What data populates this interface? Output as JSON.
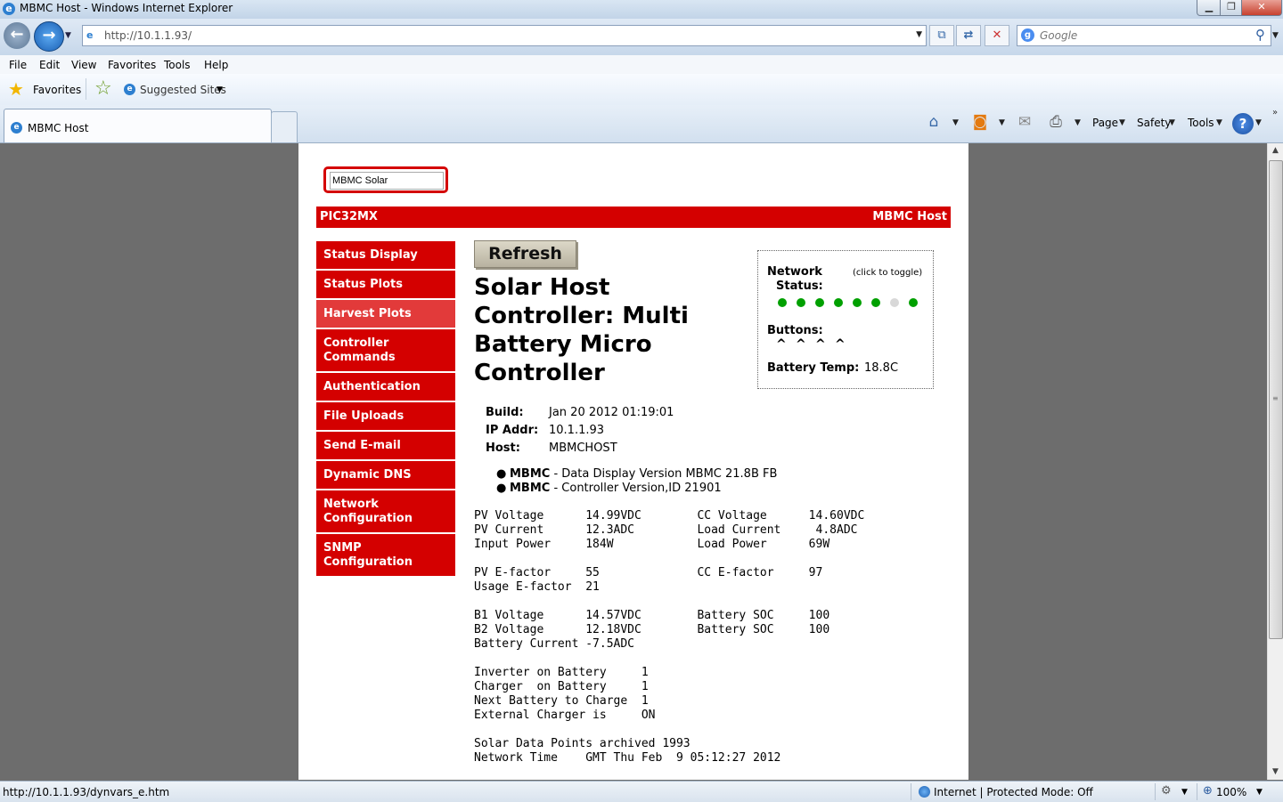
{
  "window": {
    "title": "MBMC Host - Windows Internet Explorer",
    "minimize": "▁",
    "maximize": "❐",
    "close": "✕"
  },
  "address": {
    "url": "http://10.1.1.93/",
    "search_placeholder": "Google"
  },
  "menu": [
    "File",
    "Edit",
    "View",
    "Favorites",
    "Tools",
    "Help"
  ],
  "favorites": {
    "label": "Favorites",
    "suggested": "Suggested Sites"
  },
  "tab": {
    "title": "MBMC Host"
  },
  "commands": {
    "page": "Page",
    "safety": "Safety",
    "tools": "Tools"
  },
  "page": {
    "logo_text": "MBMC Solar",
    "header_left": "PIC32MX",
    "header_right": "MBMC Host",
    "nav": [
      {
        "label": "Status Display"
      },
      {
        "label": "Status Plots"
      },
      {
        "label": "Harvest Plots"
      },
      {
        "line1": "Controller",
        "line2": "Commands"
      },
      {
        "label": "Authentication"
      },
      {
        "label": "File Uploads"
      },
      {
        "label": "Send E-mail"
      },
      {
        "label": "Dynamic DNS"
      },
      {
        "line1": "Network",
        "line2": "Configuration"
      },
      {
        "line1": "SNMP",
        "line2": "Configuration"
      }
    ],
    "refresh_button": "Refresh",
    "title_lines": [
      "Solar Host",
      "Controller: Multi",
      "Battery Micro",
      "Controller"
    ],
    "status": {
      "network_label_1": "Network",
      "network_label_2": "Status:",
      "toggle_hint": "(click to toggle)",
      "leds": [
        "on",
        "on",
        "on",
        "on",
        "on",
        "on",
        "off",
        "on"
      ],
      "led_on_color": "#00a000",
      "led_off_color": "#d8d8d8",
      "buttons_label": "Buttons:",
      "button_glyphs": [
        "^",
        "^",
        "^",
        "^"
      ],
      "battery_temp_label": "Battery Temp:",
      "battery_temp_value": "18.8C"
    },
    "info": [
      {
        "k": "Build:",
        "v": "Jan 20 2012 01:19:01"
      },
      {
        "k": "IP Addr:",
        "v": "10.1.1.93"
      },
      {
        "k": "Host:",
        "v": "MBMCHOST"
      }
    ],
    "versions": [
      {
        "name": "MBMC",
        "text": " - Data Display Version MBMC 21.8B FB"
      },
      {
        "name": "MBMC",
        "text": " - Controller Version,ID 21901"
      }
    ],
    "readings": [
      "PV Voltage      14.99VDC        CC Voltage      14.60VDC",
      "PV Current      12.3ADC         Load Current     4.8ADC",
      "Input Power     184W            Load Power      69W",
      "",
      "PV E-factor     55              CC E-factor     97",
      "Usage E-factor  21",
      "",
      "B1 Voltage      14.57VDC        Battery SOC     100",
      "B2 Voltage      12.18VDC        Battery SOC     100",
      "Battery Current -7.5ADC",
      "",
      "Inverter on Battery     1",
      "Charger  on Battery     1",
      "Next Battery to Charge  1",
      "External Charger is     ON",
      "",
      "Solar Data Points archived 1993",
      "Network Time    GMT Thu Feb  9 05:12:27 2012"
    ]
  },
  "statusbar": {
    "url": "http://10.1.1.93/dynvars_e.htm",
    "zone": "Internet | Protected Mode: Off",
    "zoom": "100%"
  },
  "colors": {
    "accent_red": "#d40000",
    "active_nav": "#e23a3a"
  }
}
